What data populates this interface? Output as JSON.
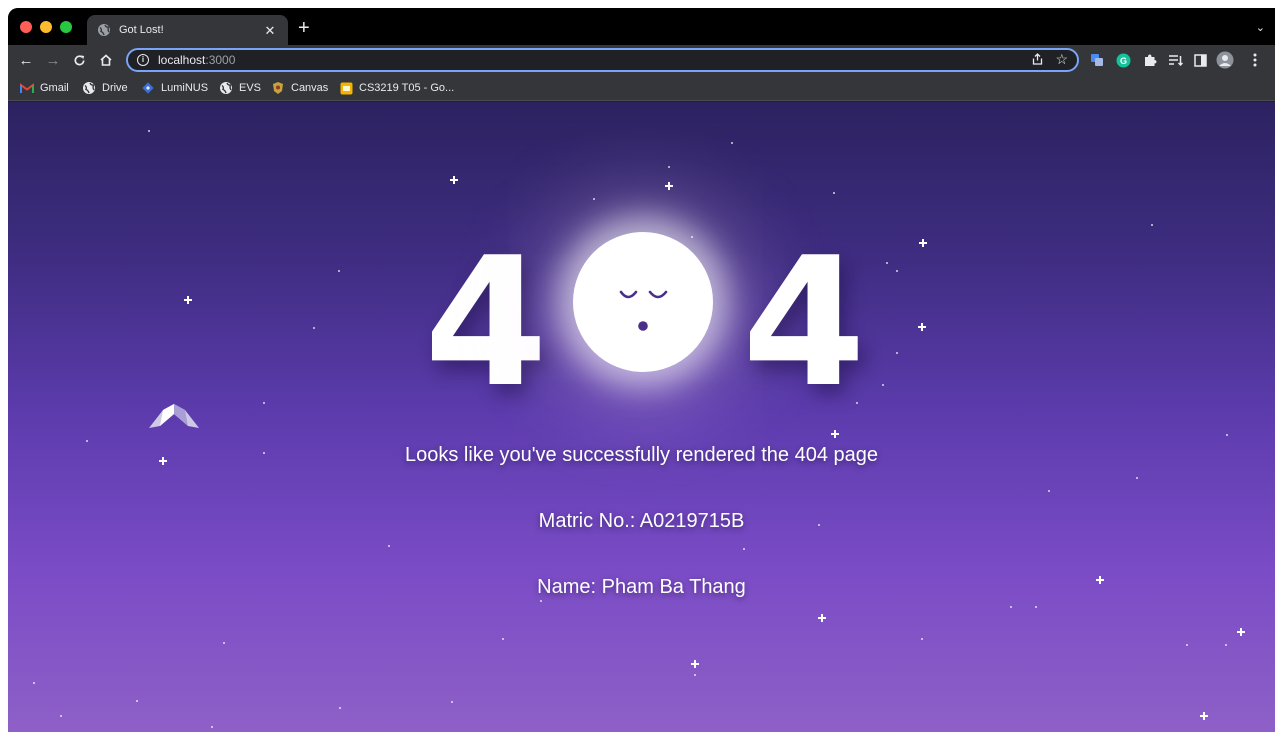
{
  "browser": {
    "tab": {
      "title": "Got Lost!",
      "icon": "globe-icon"
    },
    "new_tab_symbol": "+",
    "tab_menu_symbol": "⌄",
    "address": {
      "host": "localhost",
      "port": ":3000"
    },
    "bookmarks": [
      {
        "label": "Gmail",
        "icon": "gmail-icon"
      },
      {
        "label": "Drive",
        "icon": "globe-icon"
      },
      {
        "label": "LumiNUS",
        "icon": "luminus-icon"
      },
      {
        "label": "EVS",
        "icon": "globe-icon"
      },
      {
        "label": "Canvas",
        "icon": "canvas-icon"
      },
      {
        "label": "CS3219 T05 - Go...",
        "icon": "slides-icon"
      }
    ]
  },
  "page": {
    "digit_left": "4",
    "digit_right": "4",
    "message": "Looks like you've successfully rendered the 404 page",
    "matric": "Matric No.: A0219715B",
    "name": "Name: Pham Ba Thang"
  },
  "colors": {
    "accent": "#7aa4f8",
    "background_top": "#2c2260",
    "background_bottom": "#8e60c7",
    "moon_face": "#4b2e8a"
  }
}
